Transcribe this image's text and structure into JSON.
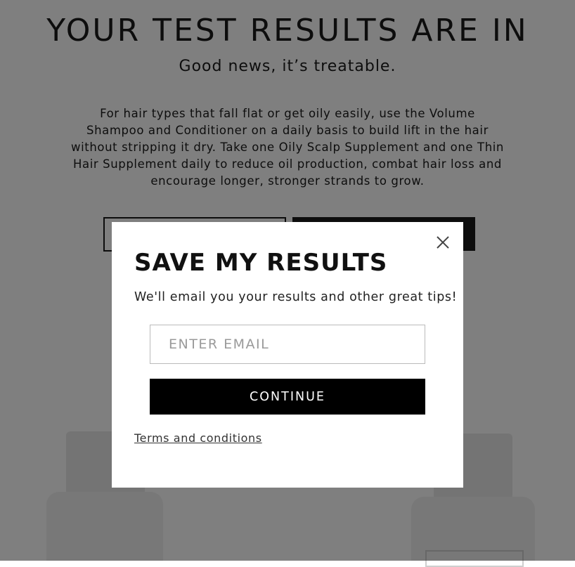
{
  "hero": {
    "title": "YOUR TEST RESULTS ARE IN",
    "subtitle": "Good news, it’s treatable.",
    "body": "For hair types that fall flat or get oily easily, use the Volume Shampoo and Conditioner on a daily basis to build lift in the hair without stripping it dry. Take one Oily Scalp Supplement and one Thin Hair Supplement daily to reduce oil production, combat hair loss and encourage longer, stronger strands to grow."
  },
  "modal": {
    "title": "SAVE MY RESULTS",
    "subtitle": "We'll email you your results and other great tips!",
    "email_placeholder": "ENTER EMAIL",
    "email_value": "",
    "continue_label": "CONTINUE",
    "terms_label": "Terms and conditions",
    "close_icon": "close-icon"
  },
  "colors": {
    "overlay": "rgba(0,0,0,0.5)",
    "primary_button": "#000000",
    "text": "#1a1a1a"
  }
}
